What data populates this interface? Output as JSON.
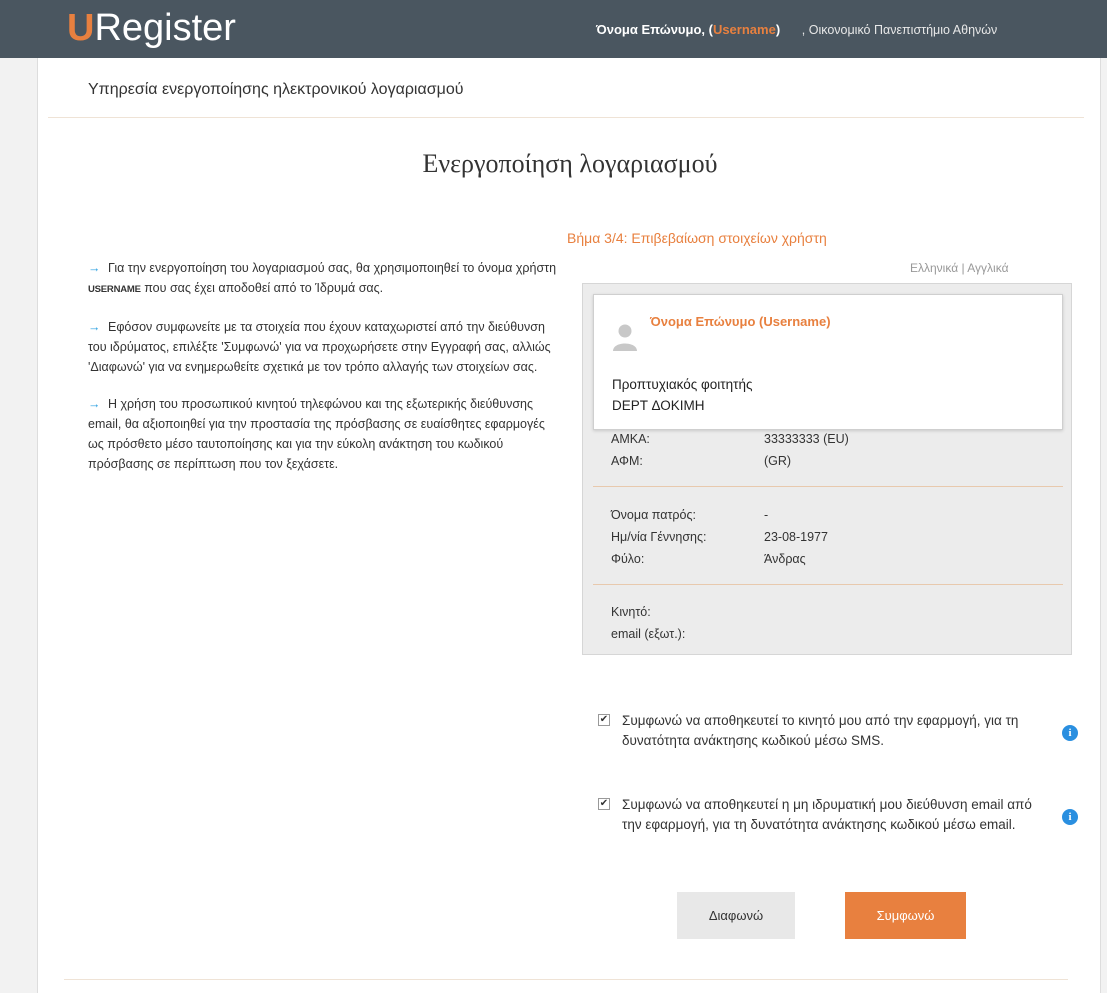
{
  "header": {
    "logo_u": "U",
    "logo_rest": "Register",
    "user_name": "Όνομα Επώνυμο, (",
    "username": "Username",
    "user_close": ")",
    "institution": ", Οικονομικό Πανεπιστήμιο Αθηνών"
  },
  "service_title": "Υπηρεσία ενεργοποίησης ηλεκτρονικού λογαριασμού",
  "main_title": "Ενεργοποίηση λογαριασμού",
  "instructions": {
    "p1_a": "Για την ενεργοποίηση του λογαριασμού σας, θα χρησιμοποιηθεί το όνομα χρήστη ",
    "p1_bold": "USERNAME",
    "p1_b": " που σας έχει αποδοθεί από το Ίδρυμά σας.",
    "p2": "Εφόσον συμφωνείτε με τα στοιχεία που έχουν καταχωριστεί από την διεύθυνση του ιδρύματος, επιλέξτε 'Συμφωνώ' για να προχωρήσετε στην Εγγραφή σας, αλλιώς 'Διαφωνώ' για να ενημερωθείτε σχετικά με τον τρόπο αλλαγής των στοιχείων σας.",
    "p3": "Η χρήση του προσωπικού κινητού τηλεφώνου και της εξωτερικής διεύθυνσης email, θα αξιοποιηθεί για την προστασία της πρόσβασης σε ευαίσθητες εφαρμογές ως πρόσθετο μέσο ταυτοποίησης και για την εύκολη ανάκτηση του κωδικού πρόσβασης σε περίπτωση που τον ξεχάσετε."
  },
  "step_title": "Βήμα 3/4: Επιβεβαίωση στοιχείων χρήστη",
  "language": {
    "greek": "Ελληνικά",
    "sep": " | ",
    "english": "Αγγλικά"
  },
  "card": {
    "name": "Όνομα Επώνυμο (Username)",
    "line1": "Προπτυχιακός φοιτητής",
    "line2": "DEPT ΔΟΚΙΜΗ"
  },
  "details": {
    "amka_label": "ΑΜΚΑ:",
    "amka_value": "33333333 (EU)",
    "afm_label": "ΑΦΜ:",
    "afm_value": "(GR)",
    "father_label": "Όνομα πατρός:",
    "father_value": "-",
    "dob_label": "Ημ/νία Γέννησης:",
    "dob_value": "23-08-1977",
    "gender_label": "Φύλο:",
    "gender_value": "Άνδρας",
    "mobile_label": "Κινητό:",
    "email_label": "email (εξωτ.):"
  },
  "consents": [
    {
      "text": "Συμφωνώ να αποθηκευτεί το κινητό μου από την εφαρμογή, για τη δυνατότητα ανάκτησης κωδικού μέσω SMS.",
      "checked": true
    },
    {
      "text": "Συμφωνώ να αποθηκευτεί η μη ιδρυματική μου διεύθυνση email από την εφαρμογή, για τη δυνατότητα ανάκτησης κωδικού μέσω email.",
      "checked": true
    }
  ],
  "buttons": {
    "disagree": "Διαφωνώ",
    "agree": "Συμφωνώ"
  },
  "colors": {
    "accent": "#e8803f",
    "header_bg": "#4a5660",
    "info_blue": "#2a8fe0"
  },
  "icons": {
    "arrow": "→",
    "check": "✔",
    "info": "i"
  }
}
